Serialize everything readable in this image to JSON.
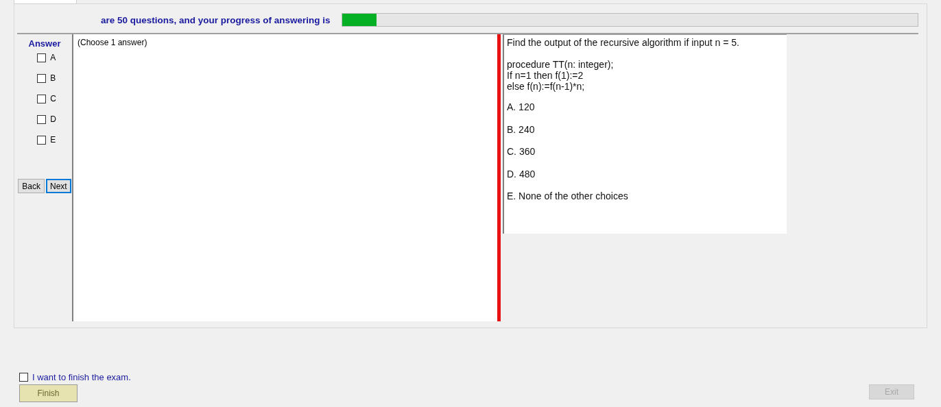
{
  "header": {
    "text": "are 50 questions, and your progress of answering is",
    "progress": {
      "level": 0.06
    }
  },
  "answer_panel": {
    "title": "Answer",
    "options": [
      {
        "label": "A",
        "checked": false
      },
      {
        "label": "B",
        "checked": false
      },
      {
        "label": "C",
        "checked": false
      },
      {
        "label": "D",
        "checked": false
      },
      {
        "label": "E",
        "checked": false
      }
    ],
    "buttons": [
      {
        "label": "Back",
        "focused": false
      },
      {
        "label": "Next",
        "focused": true
      }
    ]
  },
  "answer_box": {
    "text": "(Choose 1 answer)"
  },
  "question": {
    "prompt": "Find the output of the recursive algorithm if input n = 5.",
    "code": [
      "procedure TT(n: integer);",
      "If n=1 then f(1):=2",
      "else f(n):=f(n-1)*n;"
    ],
    "choices": [
      "A.  120",
      "B.  240",
      "C.  360",
      "D.  480",
      "E.  None of the other choices"
    ]
  },
  "footer": {
    "confirm": {
      "label": "I want to finish the exam.",
      "checked": false
    },
    "finish_button": {
      "label": "Finish",
      "disabled": true
    },
    "exit_button": {
      "label": "Exit",
      "disabled": true
    }
  }
}
